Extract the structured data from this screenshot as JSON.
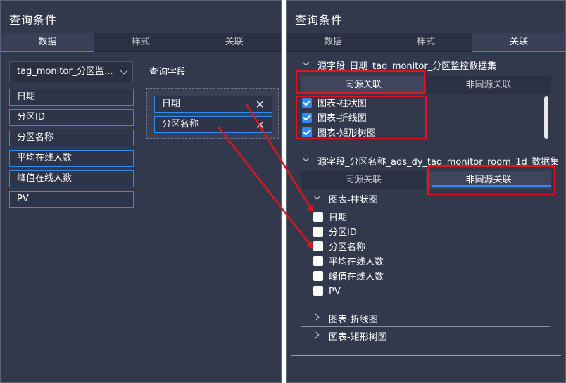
{
  "left": {
    "title": "查询条件",
    "tabs": [
      {
        "label": "数据",
        "active": true
      },
      {
        "label": "样式",
        "active": false
      },
      {
        "label": "关联",
        "active": false
      }
    ],
    "dataset": "tag_monitor_分区监...",
    "fields": [
      "日期",
      "分区ID",
      "分区名称",
      "平均在线人数",
      "峰值在线人数",
      "PV"
    ],
    "query_label": "查询字段",
    "query_fields": [
      "日期",
      "分区名称"
    ]
  },
  "right": {
    "title": "查询条件",
    "tabs": [
      {
        "label": "数据",
        "active": false
      },
      {
        "label": "样式",
        "active": false
      },
      {
        "label": "关联",
        "active": true
      }
    ],
    "section1": {
      "title": "源字段_日期_tag_monitor_分区监控数据集",
      "subtabs": [
        "同源关联",
        "非同源关联"
      ],
      "items": [
        {
          "label": "图表-柱状图",
          "checked": true
        },
        {
          "label": "图表-折线图",
          "checked": true
        },
        {
          "label": "图表-矩形树图",
          "checked": true
        }
      ]
    },
    "section2": {
      "title": "源字段_分区名称_ads_dy_tag_monitor_room_1d_数据集",
      "subtabs": [
        "同源关联",
        "非同源关联"
      ],
      "group_open": "图表-柱状图",
      "fields": [
        {
          "label": "日期",
          "checked": false
        },
        {
          "label": "分区ID",
          "checked": false
        },
        {
          "label": "分区名称",
          "checked": false
        },
        {
          "label": "平均在线人数",
          "checked": false
        },
        {
          "label": "峰值在线人数",
          "checked": false
        },
        {
          "label": "PV",
          "checked": false
        }
      ],
      "groups_closed": [
        "图表-折线图",
        "图表-矩形树图"
      ]
    }
  },
  "colors": {
    "panel_bg": "#33394d",
    "accent": "#2d8cf0",
    "annotation": "#e0141e"
  }
}
